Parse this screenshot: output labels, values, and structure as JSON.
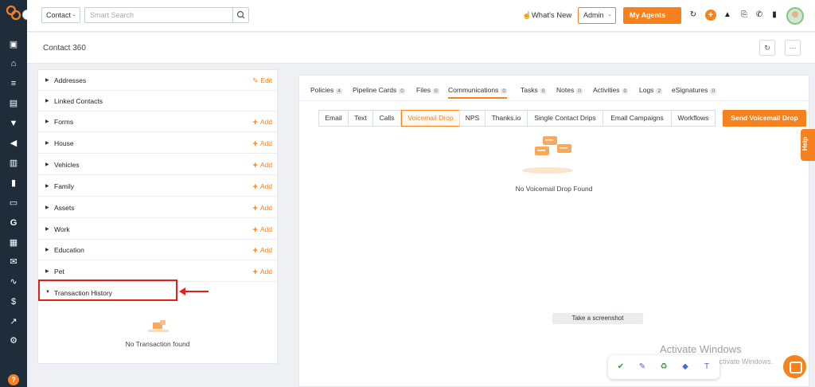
{
  "colors": {
    "accent": "#f5821f",
    "sidebar": "#1f2d3a",
    "highlight": "#e0211b"
  },
  "topbar": {
    "context_select": "Contact",
    "search_placeholder": "Smart Search",
    "whats_new": "What's New",
    "admin_select": "Admin",
    "agents_button": "My Agents"
  },
  "header": {
    "title": "Contact 360"
  },
  "left_panel": {
    "sections": [
      {
        "label": "Addresses",
        "action": "Edit"
      },
      {
        "label": "Linked Contacts",
        "action": ""
      },
      {
        "label": "Forms",
        "action": "Add"
      },
      {
        "label": "House",
        "action": "Add"
      },
      {
        "label": "Vehicles",
        "action": "Add"
      },
      {
        "label": "Family",
        "action": "Add"
      },
      {
        "label": "Assets",
        "action": "Add"
      },
      {
        "label": "Work",
        "action": "Add"
      },
      {
        "label": "Education",
        "action": "Add"
      },
      {
        "label": "Pet",
        "action": "Add"
      },
      {
        "label": "Transaction History",
        "action": ""
      }
    ],
    "empty_text": "No Transaction found"
  },
  "right_panel": {
    "tabs": [
      {
        "label": "Policies",
        "count": "4"
      },
      {
        "label": "Pipeline Cards",
        "count": "0"
      },
      {
        "label": "Files",
        "count": "0"
      },
      {
        "label": "Communications",
        "count": "0"
      },
      {
        "label": "Tasks",
        "count": "0"
      },
      {
        "label": "Notes",
        "count": "0"
      },
      {
        "label": "Activities",
        "count": "0"
      },
      {
        "label": "Logs",
        "count": "2"
      },
      {
        "label": "eSignatures",
        "count": "0"
      }
    ],
    "active_tab": "Communications",
    "subtabs": [
      "Email",
      "Text",
      "Calls",
      "Voicemail Drop",
      "NPS",
      "Thanks.io",
      "Single Contact Drips",
      "Email Campaigns",
      "Workflows"
    ],
    "active_subtab": "Voicemail Drop",
    "send_button": "Send Voicemail Drop",
    "empty_text": "No Voicemail Drop Found"
  },
  "help_tab": "Help",
  "screenshot_tip": "Take a screenshot",
  "watermark": {
    "title": "Activate Windows",
    "subtitle": "Go to Settings to activate Windows."
  },
  "icons": {
    "sidebar": [
      "copy-icon",
      "bank-icon",
      "list-icon",
      "contact-card-icon",
      "filter-icon",
      "megaphone-icon",
      "document-icon",
      "bar-chart-icon",
      "folder-icon",
      "google-icon",
      "calendar-icon",
      "mail-icon",
      "signature-icon",
      "dollar-icon",
      "trend-icon",
      "gear-icon"
    ],
    "topbar": [
      "refresh-icon",
      "plus-icon",
      "bell-icon",
      "notification-icon",
      "phone-icon",
      "calculator-icon"
    ]
  }
}
